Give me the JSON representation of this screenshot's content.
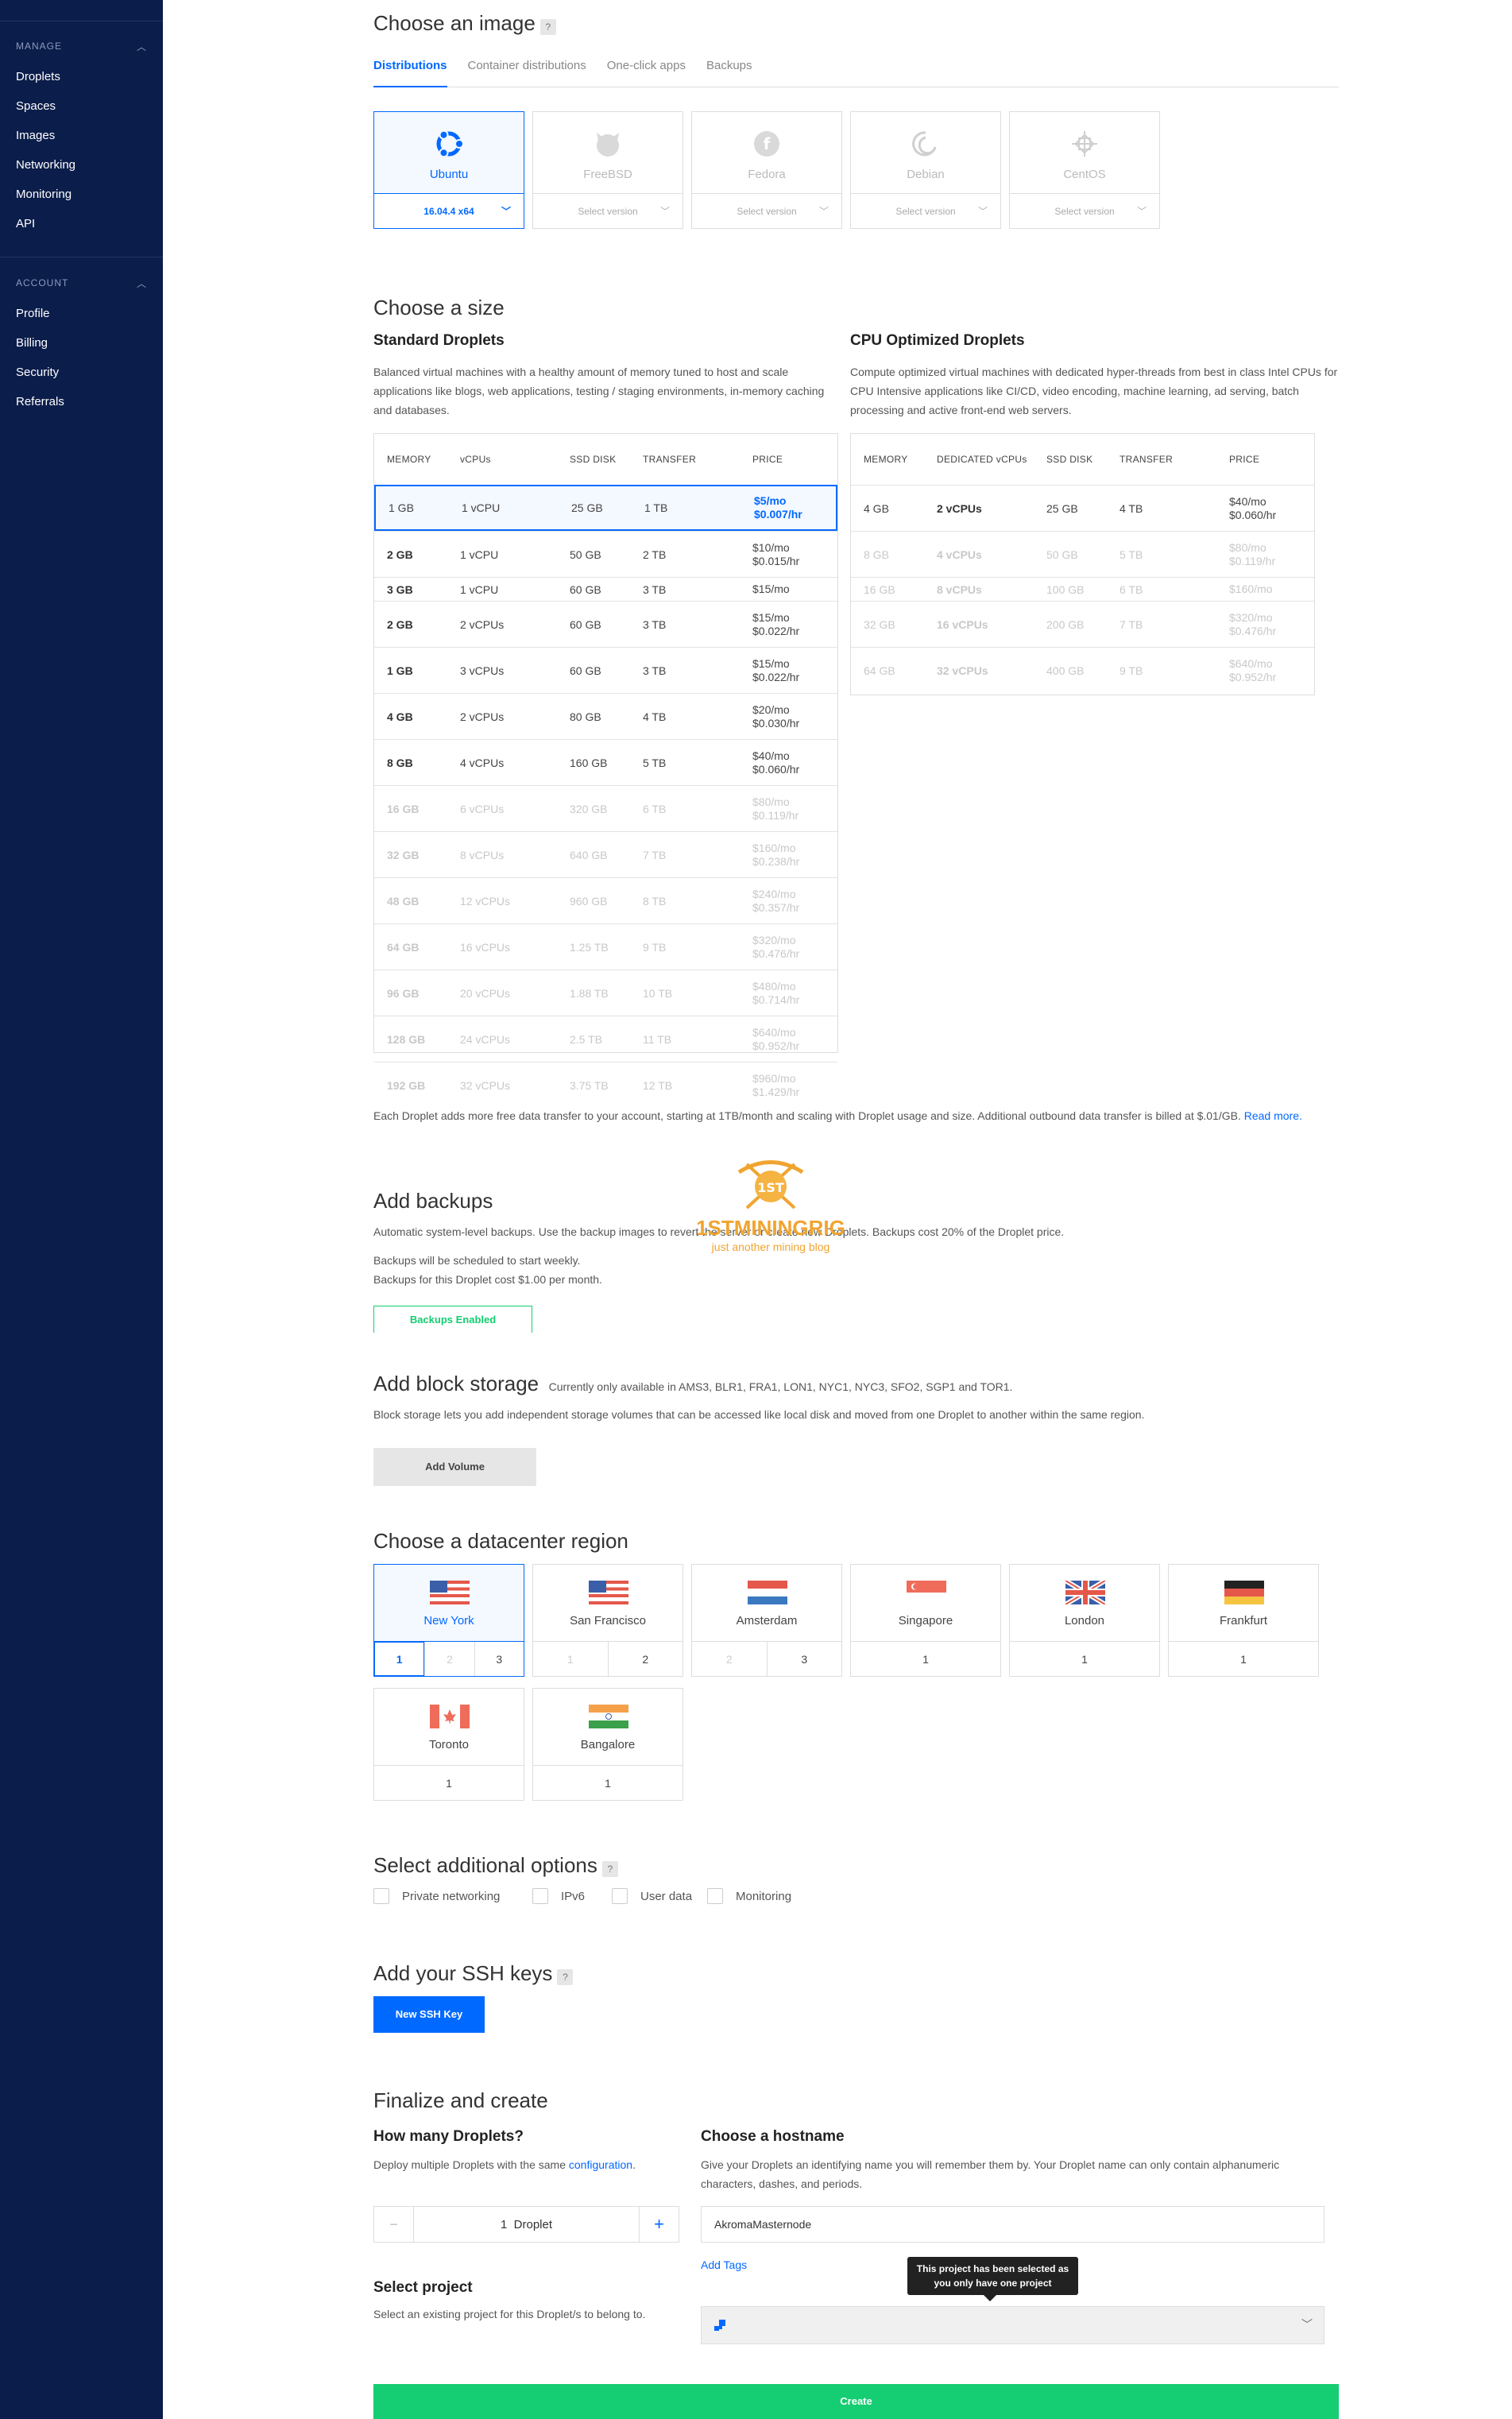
{
  "sidebar": {
    "manage_label": "MANAGE",
    "manage_items": [
      "Droplets",
      "Spaces",
      "Images",
      "Networking",
      "Monitoring",
      "API"
    ],
    "account_label": "ACCOUNT",
    "account_items": [
      "Profile",
      "Billing",
      "Security",
      "Referrals"
    ]
  },
  "image": {
    "title": "Choose an image",
    "help": "?",
    "tabs": [
      "Distributions",
      "Container distributions",
      "One-click apps",
      "Backups"
    ],
    "distros": [
      {
        "name": "Ubuntu",
        "version": "16.04.4 x64",
        "icon": "ubuntu-icon"
      },
      {
        "name": "FreeBSD",
        "version": "Select version",
        "icon": "freebsd-icon"
      },
      {
        "name": "Fedora",
        "version": "Select version",
        "icon": "fedora-icon"
      },
      {
        "name": "Debian",
        "version": "Select version",
        "icon": "debian-icon"
      },
      {
        "name": "CentOS",
        "version": "Select version",
        "icon": "centos-icon"
      }
    ]
  },
  "size": {
    "title": "Choose a size",
    "standard": {
      "title": "Standard Droplets",
      "desc": "Balanced virtual machines with a healthy amount of memory tuned to host and scale applications like blogs, web applications, testing / staging environments, in-memory caching and databases.",
      "headers": [
        "MEMORY",
        "vCPUs",
        "SSD DISK",
        "TRANSFER",
        "PRICE"
      ],
      "rows": [
        {
          "mem": "1 GB",
          "cpu": "1 vCPU",
          "disk": "25 GB",
          "transfer": "1 TB",
          "mo": "$5/mo",
          "hr": "$0.007/hr"
        },
        {
          "mem": "2 GB",
          "cpu": "1 vCPU",
          "disk": "50 GB",
          "transfer": "2 TB",
          "mo": "$10/mo",
          "hr": "$0.015/hr"
        },
        {
          "mem": "3 GB",
          "cpu": "1 vCPU",
          "disk": "60 GB",
          "transfer": "3 TB",
          "mo": "$15/mo",
          "hr": ""
        },
        {
          "mem": "2 GB",
          "cpu": "2 vCPUs",
          "disk": "60 GB",
          "transfer": "3 TB",
          "mo": "$15/mo",
          "hr": "$0.022/hr"
        },
        {
          "mem": "1 GB",
          "cpu": "3 vCPUs",
          "disk": "60 GB",
          "transfer": "3 TB",
          "mo": "$15/mo",
          "hr": "$0.022/hr"
        },
        {
          "mem": "4 GB",
          "cpu": "2 vCPUs",
          "disk": "80 GB",
          "transfer": "4 TB",
          "mo": "$20/mo",
          "hr": "$0.030/hr"
        },
        {
          "mem": "8 GB",
          "cpu": "4 vCPUs",
          "disk": "160 GB",
          "transfer": "5 TB",
          "mo": "$40/mo",
          "hr": "$0.060/hr"
        },
        {
          "mem": "16 GB",
          "cpu": "6 vCPUs",
          "disk": "320 GB",
          "transfer": "6 TB",
          "mo": "$80/mo",
          "hr": "$0.119/hr"
        },
        {
          "mem": "32 GB",
          "cpu": "8 vCPUs",
          "disk": "640 GB",
          "transfer": "7 TB",
          "mo": "$160/mo",
          "hr": "$0.238/hr"
        },
        {
          "mem": "48 GB",
          "cpu": "12 vCPUs",
          "disk": "960 GB",
          "transfer": "8 TB",
          "mo": "$240/mo",
          "hr": "$0.357/hr"
        },
        {
          "mem": "64 GB",
          "cpu": "16 vCPUs",
          "disk": "1.25 TB",
          "transfer": "9 TB",
          "mo": "$320/mo",
          "hr": "$0.476/hr"
        },
        {
          "mem": "96 GB",
          "cpu": "20 vCPUs",
          "disk": "1.88 TB",
          "transfer": "10 TB",
          "mo": "$480/mo",
          "hr": "$0.714/hr"
        },
        {
          "mem": "128 GB",
          "cpu": "24 vCPUs",
          "disk": "2.5 TB",
          "transfer": "11 TB",
          "mo": "$640/mo",
          "hr": "$0.952/hr"
        },
        {
          "mem": "192 GB",
          "cpu": "32 vCPUs",
          "disk": "3.75 TB",
          "transfer": "12 TB",
          "mo": "$960/mo",
          "hr": "$1.429/hr"
        }
      ]
    },
    "cpu": {
      "title": "CPU Optimized Droplets",
      "desc": "Compute optimized virtual machines with dedicated hyper-threads from best in class Intel CPUs for CPU Intensive applications like CI/CD, video encoding, machine learning, ad serving, batch processing and active front-end web servers.",
      "headers": [
        "MEMORY",
        "DEDICATED vCPUs",
        "SSD DISK",
        "TRANSFER",
        "PRICE"
      ],
      "rows": [
        {
          "mem": "4 GB",
          "cpu": "2 vCPUs",
          "disk": "25 GB",
          "transfer": "4 TB",
          "mo": "$40/mo",
          "hr": "$0.060/hr"
        },
        {
          "mem": "8 GB",
          "cpu": "4 vCPUs",
          "disk": "50 GB",
          "transfer": "5 TB",
          "mo": "$80/mo",
          "hr": "$0.119/hr"
        },
        {
          "mem": "16 GB",
          "cpu": "8 vCPUs",
          "disk": "100 GB",
          "transfer": "6 TB",
          "mo": "$160/mo",
          "hr": ""
        },
        {
          "mem": "32 GB",
          "cpu": "16 vCPUs",
          "disk": "200 GB",
          "transfer": "7 TB",
          "mo": "$320/mo",
          "hr": "$0.476/hr"
        },
        {
          "mem": "64 GB",
          "cpu": "32 vCPUs",
          "disk": "400 GB",
          "transfer": "9 TB",
          "mo": "$640/mo",
          "hr": "$0.952/hr"
        }
      ]
    },
    "note": "Each Droplet adds more free data transfer to your account, starting at 1TB/month and scaling with Droplet usage and size. Additional outbound data transfer is billed at $.01/GB.",
    "read_more": "Read more."
  },
  "backups": {
    "title": "Add backups",
    "desc": "Automatic system-level backups. Use the backup images to revert the server or create new Droplets. Backups cost 20% of the Droplet price.",
    "line1": "Backups will be scheduled to start weekly.",
    "line2": "Backups for this Droplet cost $1.00 per month.",
    "button": "Backups Enabled"
  },
  "storage": {
    "title": "Add block storage",
    "availability": "Currently only available in AMS3, BLR1, FRA1, LON1, NYC1, NYC3, SFO2, SGP1 and TOR1.",
    "desc": "Block storage lets you add independent storage volumes that can be accessed like local disk and moved from one Droplet to another within the same region.",
    "button": "Add Volume"
  },
  "region": {
    "title": "Choose a datacenter region",
    "regions": [
      {
        "name": "New York",
        "nums": [
          "1",
          "2",
          "3"
        ]
      },
      {
        "name": "San Francisco",
        "nums": [
          "1",
          "2"
        ]
      },
      {
        "name": "Amsterdam",
        "nums": [
          "2",
          "3"
        ]
      },
      {
        "name": "Singapore",
        "nums": [
          "1"
        ]
      },
      {
        "name": "London",
        "nums": [
          "1"
        ]
      },
      {
        "name": "Frankfurt",
        "nums": [
          "1"
        ]
      },
      {
        "name": "Toronto",
        "nums": [
          "1"
        ]
      },
      {
        "name": "Bangalore",
        "nums": [
          "1"
        ]
      }
    ]
  },
  "options": {
    "title": "Select additional options",
    "help": "?",
    "items": [
      "Private networking",
      "IPv6",
      "User data",
      "Monitoring"
    ]
  },
  "ssh": {
    "title": "Add your SSH keys",
    "help": "?",
    "button": "New SSH Key"
  },
  "finalize": {
    "title": "Finalize and create",
    "how_many_title": "How many Droplets?",
    "how_many_desc_pre": "Deploy multiple Droplets with the same",
    "how_many_link": "configuration",
    "how_many_desc_post": ".",
    "minus": "−",
    "count": "1  Droplet",
    "plus": "+",
    "hostname_title": "Choose a hostname",
    "hostname_desc": "Give your Droplets an identifying name you will remember them by. Your Droplet name can only contain alphanumeric characters, dashes, and periods.",
    "hostname_value": "AkromaMasternode",
    "add_tags": "Add Tags",
    "project_title": "Select project",
    "project_desc": "Select an existing project for this Droplet/s to belong to.",
    "tooltip": "This project has been selected as you only have one project",
    "create": "Create"
  },
  "watermark": {
    "badge": "1ST",
    "brand": "1STMININGRIG",
    "tagline": "just another mining blog"
  },
  "colors": {
    "sidebar_bg": "#0b1d4a",
    "accent_blue": "#0069ff",
    "accent_green": "#15cd72"
  }
}
